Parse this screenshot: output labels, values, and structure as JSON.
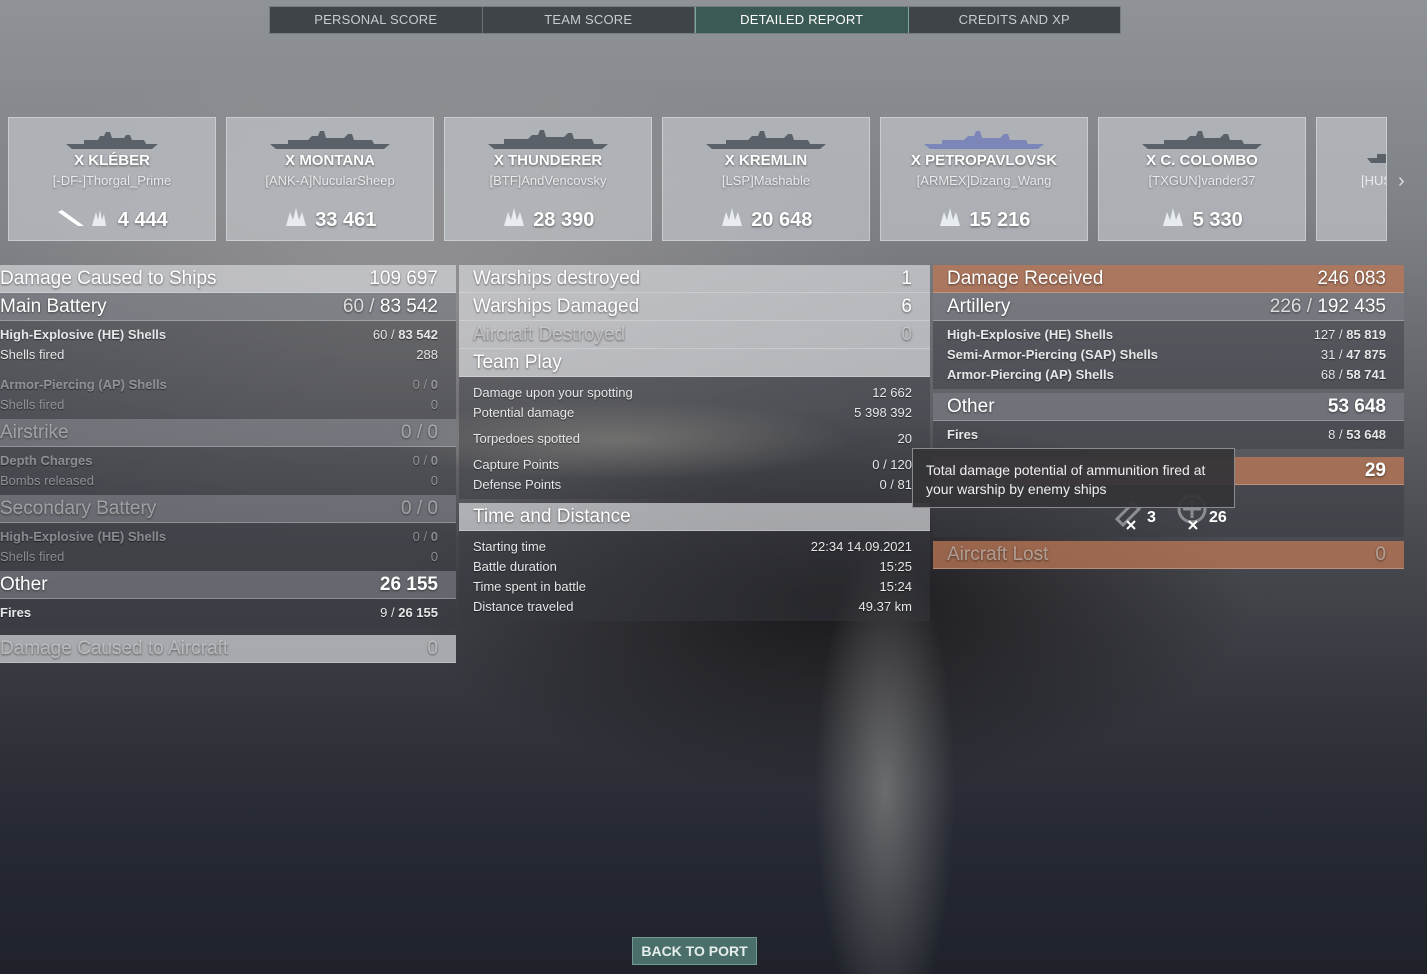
{
  "tabs": [
    {
      "label": "PERSONAL SCORE"
    },
    {
      "label": "TEAM SCORE"
    },
    {
      "label": "DETAILED REPORT"
    },
    {
      "label": "CREDITS AND XP"
    }
  ],
  "cards": [
    {
      "ship": "X KLÉBER",
      "player": "[-DF-]Thorgal_Prime",
      "score": "4 444"
    },
    {
      "ship": "X MONTANA",
      "player": "[ANK-A]NucularSheep",
      "score": "33 461"
    },
    {
      "ship": "X THUNDERER",
      "player": "[BTF]AndVencovsky",
      "score": "28 390"
    },
    {
      "ship": "X KREMLIN",
      "player": "[LSP]Mashable",
      "score": "20 648"
    },
    {
      "ship": "X PETROPAVLOVSK",
      "player": "[ARMEX]Dizang_Wang",
      "score": "15 216"
    },
    {
      "ship": "X C. COLOMBO",
      "player": "[TXGUN]vander37",
      "score": "5 330"
    },
    {
      "ship": "",
      "player": "[HUS",
      "score": ""
    }
  ],
  "left": {
    "damage_ships": {
      "label": "Damage Caused to Ships",
      "value": "109 697"
    },
    "main_battery": {
      "label": "Main Battery",
      "a": "60 /",
      "b": "83 542"
    },
    "he": {
      "label": "High-Explosive (HE) Shells",
      "a": "60 /",
      "b": "83 542"
    },
    "he_fired": {
      "label": "Shells fired",
      "value": "288"
    },
    "ap": {
      "label": "Armor-Piercing (AP) Shells",
      "a": "0 /",
      "b": "0"
    },
    "ap_fired": {
      "label": "Shells fired",
      "value": "0"
    },
    "airstrike": {
      "label": "Airstrike",
      "a": "0 /",
      "b": "0"
    },
    "depth": {
      "label": "Depth Charges",
      "a": "0 /",
      "b": "0"
    },
    "bombs": {
      "label": "Bombs released",
      "value": "0"
    },
    "secondary": {
      "label": "Secondary Battery",
      "a": "0 /",
      "b": "0"
    },
    "sec_he": {
      "label": "High-Explosive (HE) Shells",
      "a": "0 /",
      "b": "0"
    },
    "sec_fired": {
      "label": "Shells fired",
      "value": "0"
    },
    "other": {
      "label": "Other",
      "value": "26 155"
    },
    "fires": {
      "label": "Fires",
      "a": "9 /",
      "b": "26 155"
    },
    "aircraft": {
      "label": "Damage Caused to Aircraft",
      "value": "0"
    }
  },
  "mid": {
    "destroyed": {
      "label": "Warships destroyed",
      "value": "1"
    },
    "damaged": {
      "label": "Warships Damaged",
      "value": "6"
    },
    "aircraft": {
      "label": "Aircraft Destroyed",
      "value": "0"
    },
    "team_play": {
      "label": "Team Play"
    },
    "spotting": {
      "label": "Damage upon your spotting",
      "value": "12 662"
    },
    "potential": {
      "label": "Potential damage",
      "value": "5 398 392"
    },
    "torpedoes": {
      "label": "Torpedoes spotted",
      "value": "20"
    },
    "capture": {
      "label": "Capture Points",
      "value": "0 / 120"
    },
    "defense": {
      "label": "Defense Points",
      "value": "0 / 81"
    },
    "time_dist": {
      "label": "Time and Distance"
    },
    "start": {
      "label": "Starting time",
      "value": "22:34  14.09.2021"
    },
    "duration": {
      "label": "Battle duration",
      "value": "15:25"
    },
    "spent": {
      "label": "Time spent in battle",
      "value": "15:24"
    },
    "distance": {
      "label": "Distance traveled",
      "value": "49.37 km"
    }
  },
  "right": {
    "received": {
      "label": "Damage Received",
      "value": "246 083"
    },
    "artillery": {
      "label": "Artillery",
      "a": "226 /",
      "b": "192 435"
    },
    "he": {
      "label": "High-Explosive (HE) Shells",
      "a": "127 /",
      "b": "85 819"
    },
    "sap": {
      "label": "Semi-Armor-Piercing (SAP) Shells",
      "a": "31 /",
      "b": "47 875"
    },
    "ap": {
      "label": "Armor-Piercing (AP) Shells",
      "a": "68 /",
      "b": "58 741"
    },
    "other": {
      "label": "Other",
      "value": "53 648"
    },
    "fires": {
      "label": "Fires",
      "a": "8 /",
      "b": "53 648"
    },
    "ribbon_value": "29",
    "count_a": "3",
    "count_b": "26",
    "aircraft_lost": {
      "label": "Aircraft Lost",
      "value": "0"
    }
  },
  "tooltip": "Total damage potential of ammunition fired at your warship by enemy ships",
  "back_button": "BACK TO PORT"
}
